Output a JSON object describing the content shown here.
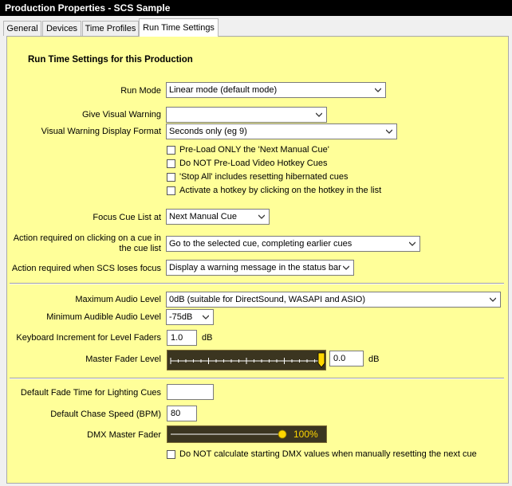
{
  "window": {
    "title": "Production Properties - SCS Sample"
  },
  "tabs": [
    {
      "label": "General"
    },
    {
      "label": "Devices"
    },
    {
      "label": "Time Profiles"
    },
    {
      "label": "Run Time Settings"
    }
  ],
  "active_tab": "Run Time Settings",
  "panel": {
    "heading": "Run Time Settings for this Production",
    "run_mode": {
      "label": "Run Mode",
      "value": "Linear mode (default mode)"
    },
    "visual_warning": {
      "label": "Give Visual Warning",
      "value": ""
    },
    "warning_format": {
      "label": "Visual Warning Display Format",
      "value": "Seconds only (eg 9)"
    },
    "checkboxes": [
      {
        "label": "Pre-Load ONLY the 'Next Manual Cue'",
        "checked": false
      },
      {
        "label": "Do NOT Pre-Load Video Hotkey Cues",
        "checked": false
      },
      {
        "label": "'Stop All' includes resetting hibernated cues",
        "checked": false
      },
      {
        "label": "Activate a hotkey by clicking on the hotkey in the list",
        "checked": false
      }
    ],
    "focus_cue": {
      "label": "Focus Cue List at",
      "value": "Next Manual Cue"
    },
    "click_action": {
      "label_line1": "Action required on clicking on a cue in",
      "label_line2": "the cue list",
      "value": "Go to the selected cue, completing earlier cues"
    },
    "loses_focus": {
      "label": "Action required when SCS loses focus",
      "value": "Display a warning message in the status bar"
    },
    "max_audio": {
      "label": "Maximum Audio Level",
      "value": "0dB (suitable for DirectSound, WASAPI and ASIO)"
    },
    "min_audio": {
      "label": "Minimum Audible Audio Level",
      "value": "-75dB"
    },
    "keyboard_increment": {
      "label": "Keyboard Increment for Level Faders",
      "value": "1.0",
      "unit": "dB"
    },
    "master_fader": {
      "label": "Master Fader Level",
      "value": "0.0",
      "unit": "dB",
      "level": 1.0
    },
    "fade_time": {
      "label": "Default Fade Time for Lighting Cues",
      "value": ""
    },
    "chase_speed": {
      "label": "Default Chase Speed (BPM)",
      "value": "80"
    },
    "dmx_master": {
      "label": "DMX Master Fader",
      "value": "100%",
      "level": 1.0
    },
    "dmx_checkbox": {
      "label": "Do NOT calculate starting DMX values when manually resetting the next cue",
      "checked": false
    }
  },
  "colors": {
    "panel_bg": "#ffff99",
    "fader_bg": "#3b3520",
    "knob": "#ffd700",
    "dmx_text": "#ffd700"
  }
}
